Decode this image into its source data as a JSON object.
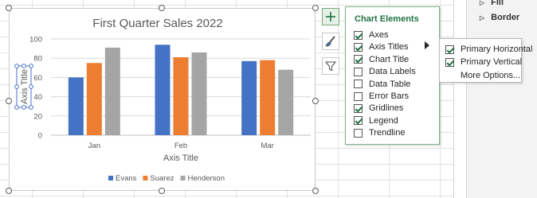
{
  "chart_data": {
    "type": "bar",
    "title": "First Quarter Sales 2022",
    "xlabel": "Axis Title",
    "ylabel": "Axis Title",
    "categories": [
      "Jan",
      "Feb",
      "Mar"
    ],
    "ylim": [
      0,
      100
    ],
    "yticks": [
      "0",
      "20",
      "40",
      "60",
      "80",
      "100"
    ],
    "grid": true,
    "legend_position": "bottom",
    "series": [
      {
        "name": "Evans",
        "color": "#4472C4",
        "values": [
          60,
          94,
          77
        ]
      },
      {
        "name": "Suarez",
        "color": "#ED7D31",
        "values": [
          75,
          81,
          78
        ]
      },
      {
        "name": "Henderson",
        "color": "#A5A5A5",
        "values": [
          91,
          86,
          68
        ]
      }
    ]
  },
  "flyout": {
    "title": "Chart Elements",
    "items": [
      {
        "label": "Axes",
        "checked": true
      },
      {
        "label": "Axis Titles",
        "checked": true
      },
      {
        "label": "Chart Title",
        "checked": true
      },
      {
        "label": "Data Labels",
        "checked": false
      },
      {
        "label": "Data Table",
        "checked": false
      },
      {
        "label": "Error Bars",
        "checked": false
      },
      {
        "label": "Gridlines",
        "checked": true
      },
      {
        "label": "Legend",
        "checked": true
      },
      {
        "label": "Trendline",
        "checked": false
      }
    ]
  },
  "submenu": {
    "items": [
      {
        "label": "Primary Horizontal",
        "checked": true
      },
      {
        "label": "Primary Vertical",
        "checked": true
      }
    ],
    "more_options": "More Options..."
  },
  "format_pane": {
    "fill_label": "Fill",
    "border_label": "Border"
  },
  "icons": {
    "chart_elements": "plus-icon",
    "chart_styles": "paintbrush-icon",
    "chart_filters": "funnel-icon"
  }
}
